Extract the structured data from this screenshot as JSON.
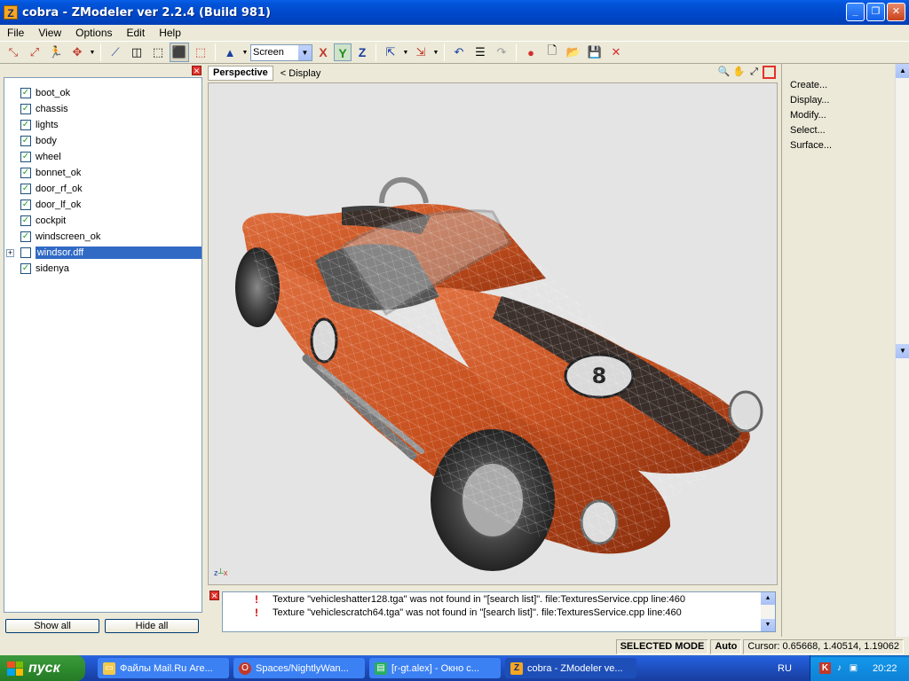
{
  "window": {
    "title": "cobra - ZModeler ver 2.2.4 (Build 981)",
    "icon_letter": "Z"
  },
  "menu": [
    "File",
    "View",
    "Options",
    "Edit",
    "Help"
  ],
  "toolbar": {
    "view_select": "Screen",
    "axis_x": "X",
    "axis_y": "Y",
    "axis_z": "Z"
  },
  "tree": {
    "items": [
      {
        "label": "boot_ok",
        "checked": true
      },
      {
        "label": "chassis",
        "checked": true
      },
      {
        "label": "lights",
        "checked": true
      },
      {
        "label": "body",
        "checked": true
      },
      {
        "label": "wheel",
        "checked": true
      },
      {
        "label": "bonnet_ok",
        "checked": true
      },
      {
        "label": "door_rf_ok",
        "checked": true
      },
      {
        "label": "door_lf_ok",
        "checked": true
      },
      {
        "label": "cockpit",
        "checked": true
      },
      {
        "label": "windscreen_ok",
        "checked": true
      },
      {
        "label": "windsor.dff",
        "checked": false
      },
      {
        "label": "sidenya",
        "checked": true
      }
    ],
    "show_all": "Show all",
    "hide_all": "Hide all"
  },
  "viewport": {
    "tab": "Perspective",
    "display": "< Display",
    "axis_z": "z",
    "axis_x": "x"
  },
  "right_panel": [
    "Create...",
    "Display...",
    "Modify...",
    "Select...",
    "Surface..."
  ],
  "log": [
    "Texture \"vehicleshatter128.tga\" was not found in \"[search list]\". file:TexturesService.cpp line:460",
    "Texture \"vehiclescratch64.tga\" was not found in \"[search list]\". file:TexturesService.cpp line:460"
  ],
  "status": {
    "mode": "SELECTED MODE",
    "auto": "Auto",
    "cursor": "Cursor: 0.65668, 1.40514, 1.19062"
  },
  "taskbar": {
    "start": "пуск",
    "tasks": [
      "Файлы Mail.Ru Аге...",
      "Spaces/NightlyWan...",
      "[r-gt.alex] - Окно с...",
      "cobra - ZModeler ve..."
    ],
    "lang": "RU",
    "clock": "20:22"
  },
  "colors": {
    "car_paint": "#c8511f",
    "stripe": "#2b2b2b",
    "viewport_bg": "#e4e4e4",
    "selection": "#316ac5"
  }
}
